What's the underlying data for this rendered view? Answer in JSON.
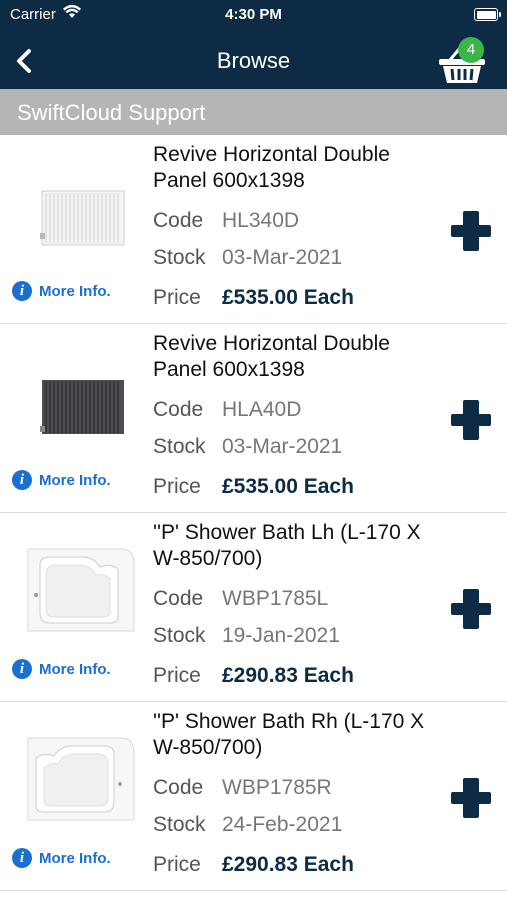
{
  "status": {
    "carrier": "Carrier",
    "time": "4:30 PM"
  },
  "nav": {
    "title": "Browse",
    "basket_count": "4"
  },
  "section": {
    "title": "SwiftCloud Support"
  },
  "labels": {
    "code": "Code",
    "stock": "Stock",
    "price": "Price",
    "more_info": "More Info."
  },
  "colors": {
    "navy": "#0d2b45",
    "badge_green": "#3cb44a",
    "link_blue": "#1a6fd1",
    "section_gray": "#b5b5b5"
  },
  "products": [
    {
      "title": "Revive Horizontal Double Panel 600x1398",
      "code": "HL340D",
      "stock": "03-Mar-2021",
      "price": "£535.00 Each",
      "image": "white-radiator"
    },
    {
      "title": "Revive Horizontal Double Panel 600x1398",
      "code": "HLA40D",
      "stock": "03-Mar-2021",
      "price": "£535.00 Each",
      "image": "anthracite-radiator"
    },
    {
      "title": "''P' Shower Bath Lh (L-170 X W-850/700)",
      "code": "WBP1785L",
      "stock": "19-Jan-2021",
      "price": "£290.83 Each",
      "image": "p-shower-bath-left"
    },
    {
      "title": "''P' Shower Bath Rh (L-170 X W-850/700)",
      "code": "WBP1785R",
      "stock": "24-Feb-2021",
      "price": "£290.83 Each",
      "image": "p-shower-bath-right"
    }
  ]
}
